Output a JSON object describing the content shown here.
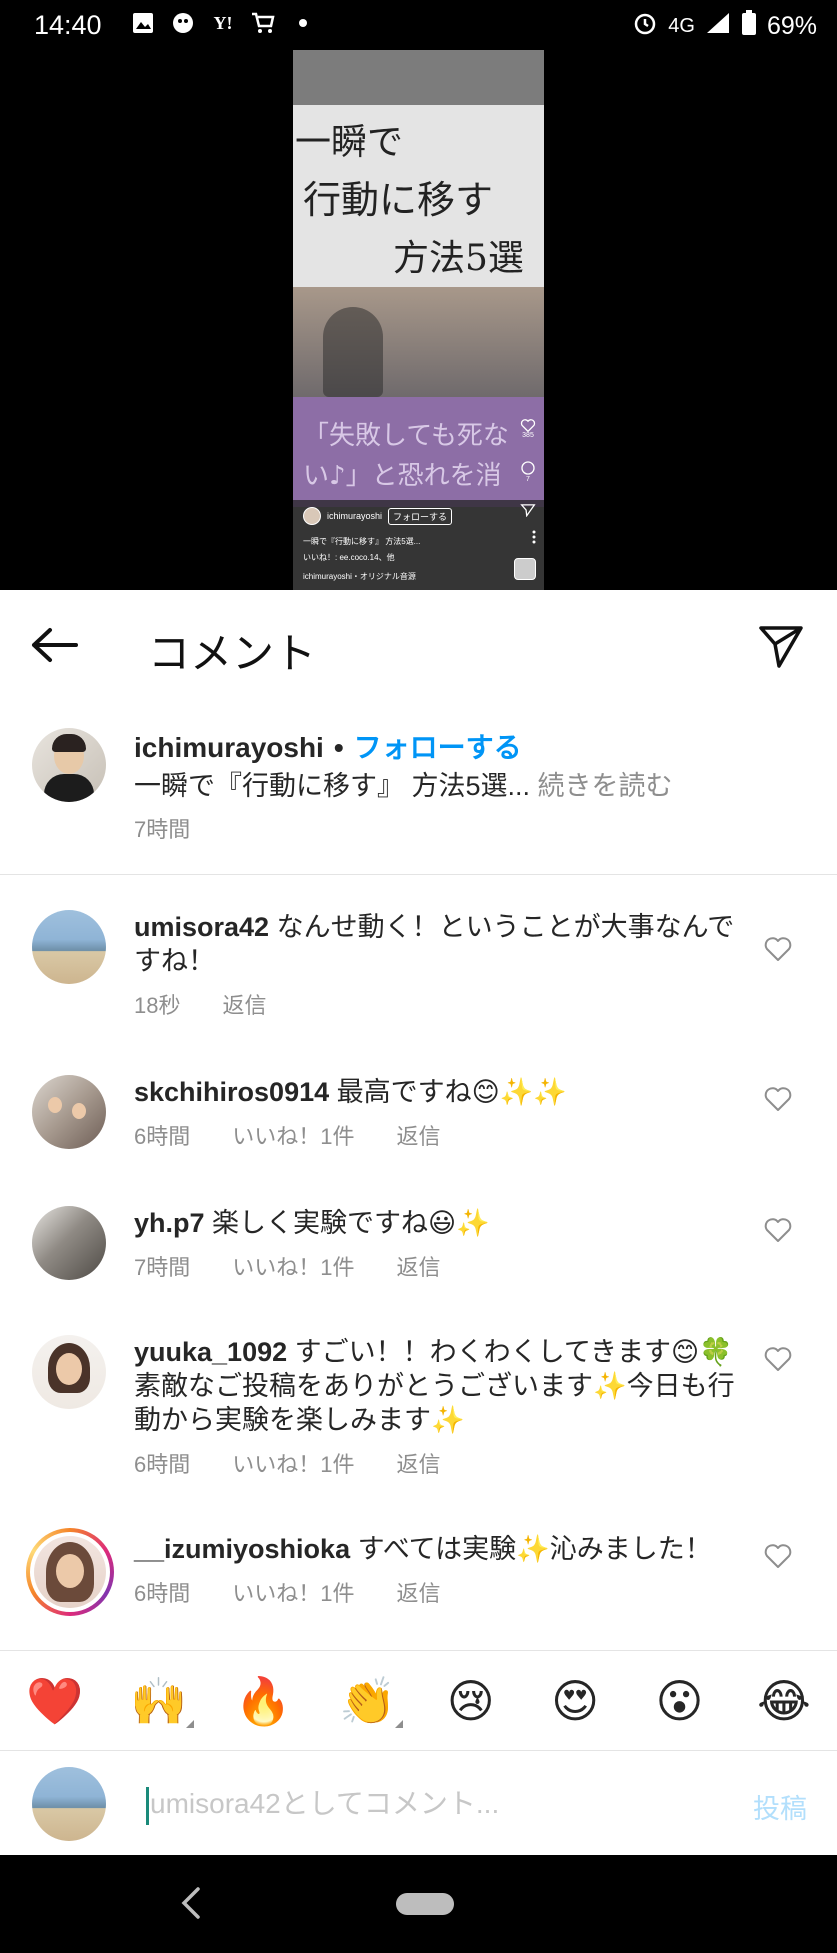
{
  "status_bar": {
    "time": "14:40",
    "network": "4G",
    "battery": "69%"
  },
  "video": {
    "overlay_line1": "一瞬で",
    "overlay_line2": "行動に移す",
    "overlay_line3": "方法5選",
    "purple_line1": "「失敗しても死な",
    "purple_line2": "い♪」と恐れを消",
    "username": "ichimurayoshi",
    "follow_label": "フォローする",
    "caption": "一瞬で『行動に移す』 方法5選...",
    "likes_text": "いいね！: ee.coco.14、他",
    "audio_text": "ichimurayoshi・オリジナル音源",
    "like_count": "385",
    "comment_count": "7"
  },
  "header": {
    "title": "コメント"
  },
  "caption_block": {
    "username": "ichimurayoshi",
    "separator": "•",
    "follow_label": "フォローする",
    "text": "一瞬で『行動に移す』 方法5選... ",
    "more_label": "続きを読む",
    "time": "7時間"
  },
  "comments": [
    {
      "username": "umisora42",
      "text": " なんせ動く！ということが大事なんですね！",
      "time": "18秒",
      "likes": "",
      "reply": "返信"
    },
    {
      "username": "skchihiros0914",
      "text": " 最高ですね😊✨✨",
      "time": "6時間",
      "likes": "いいね！1件",
      "reply": "返信"
    },
    {
      "username": "yh.p7",
      "text": " 楽しく実験ですね😃✨",
      "time": "7時間",
      "likes": "いいね！1件",
      "reply": "返信"
    },
    {
      "username": "yuuka_1092",
      "text": " すごい！！わくわくしてきます😊🍀素敵なご投稿をありがとうございます✨今日も行動から実験を楽しみます✨",
      "time": "6時間",
      "likes": "いいね！1件",
      "reply": "返信"
    },
    {
      "username": "__izumiyoshioka",
      "text": " すべては実験✨沁みました！",
      "time": "6時間",
      "likes": "いいね！1件",
      "reply": "返信"
    }
  ],
  "emoji_bar": [
    "❤️",
    "🙌",
    "🔥",
    "👏",
    "😢",
    "😍",
    "😮",
    "😂"
  ],
  "input_bar": {
    "placeholder": "umisora42としてコメント...",
    "post_label": "投稿"
  },
  "colors": {
    "link_blue": "#0095f6",
    "muted_text": "#8e8e8e",
    "post_disabled": "#b2dffc"
  }
}
